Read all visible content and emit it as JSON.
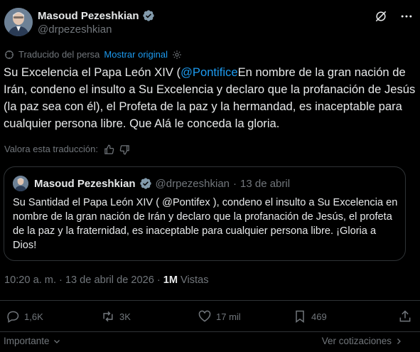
{
  "author": {
    "name": "Masoud Pezeshkian",
    "handle": "@drpezeshkian"
  },
  "translation": {
    "label": "Traducido del persa",
    "show_original": "Mostrar original"
  },
  "tweet": {
    "text_before": "Su Excelencia el Papa León XIV (",
    "mention": "@Pontifice",
    "text_after": "En nombre de la gran nación de Irán, condeno el insulto a Su Excelencia y declaro que la profanación de Jesús (la paz sea con él), el Profeta de la paz y la hermandad, es inaceptable para cualquier persona libre. Que Alá le conceda la gloria."
  },
  "rate_translation": "Valora esta traducción:",
  "quote": {
    "name": "Masoud Pezeshkian",
    "handle": "@drpezeshkian",
    "dot": "·",
    "date": "13 de abril",
    "text": "Su Santidad el Papa León XIV ( @Pontifex ), condeno el insulto a Su Excelencia en nombre de la gran nación de Irán y declaro que la profanación de Jesús, el profeta de la paz y la fraternidad, es inaceptable para cualquier persona libre. ¡Gloria a Dios!"
  },
  "meta": {
    "time": "10:20 a. m.",
    "sep": "·",
    "date": "13 de abril de 2026",
    "views_count": "1M",
    "views_label": "Vistas"
  },
  "actions": {
    "replies": "1,6K",
    "reposts": "3K",
    "likes": "17 mil",
    "bookmarks": "469"
  },
  "footer": {
    "sort": "Importante",
    "quotes": "Ver cotizaciones"
  },
  "colors": {
    "background": "#000000",
    "text": "#e7e9ea",
    "muted": "#71767b",
    "accent": "#1d9bf0",
    "border": "#2f3336"
  }
}
